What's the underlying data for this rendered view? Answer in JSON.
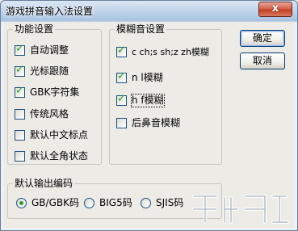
{
  "window": {
    "title": "游戏拼音输入法设置",
    "close_label": "x"
  },
  "function_group": {
    "title": "功能设置",
    "items": [
      {
        "label": "自动调整",
        "checked": true
      },
      {
        "label": "光标跟随",
        "checked": true
      },
      {
        "label": "GBK字符集",
        "checked": true
      },
      {
        "label": "传统风格",
        "checked": false
      },
      {
        "label": "默认中文标点",
        "checked": false
      },
      {
        "label": "默认全角状态",
        "checked": false
      }
    ]
  },
  "fuzzy_group": {
    "title": "模糊音设置",
    "items": [
      {
        "label": "c ch;s sh;z zh模糊",
        "checked": true
      },
      {
        "label": "n l模糊",
        "checked": true
      },
      {
        "label": "h f模糊",
        "checked": true,
        "focused": true
      },
      {
        "label": "后鼻音模糊",
        "checked": false
      }
    ]
  },
  "buttons": {
    "ok": "确定",
    "cancel": "取消"
  },
  "encoding_group": {
    "title": "默认输出编码",
    "options": [
      {
        "label": "GB/GBK码",
        "selected": true
      },
      {
        "label": "BIG5码",
        "selected": false
      },
      {
        "label": "SJIS码",
        "selected": false
      }
    ]
  },
  "watermark": {
    "icon": "download-site-logo-icon"
  },
  "colors": {
    "check": "#21a121",
    "frame": "#6a7f9a"
  }
}
